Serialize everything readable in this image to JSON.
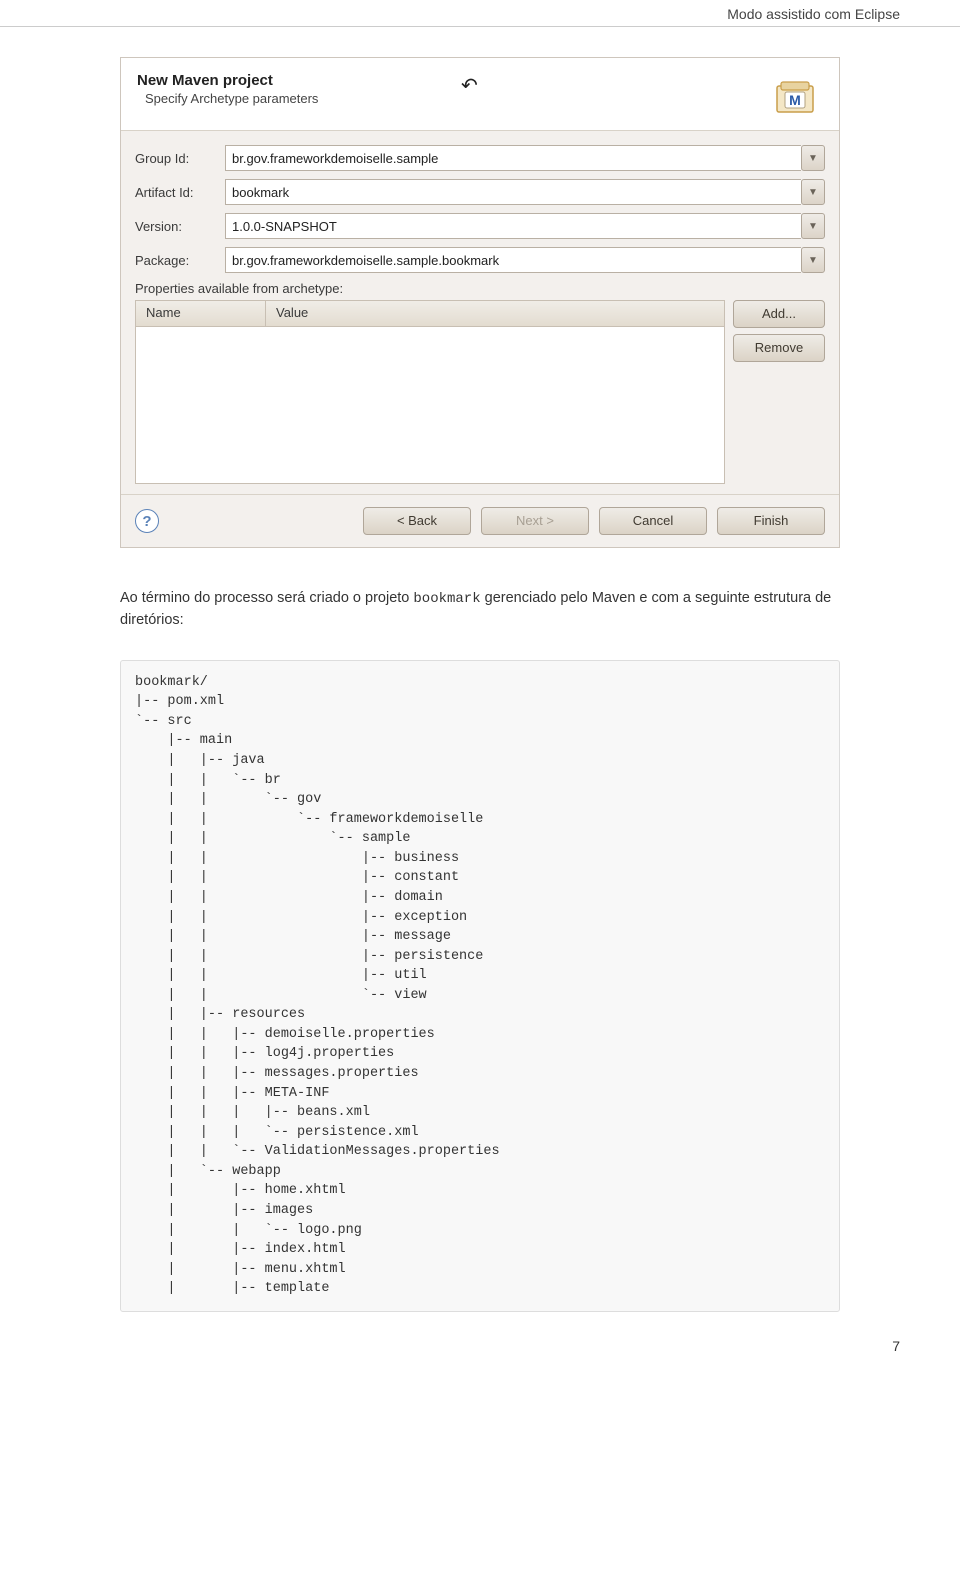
{
  "section_header": "Modo assistido com Eclipse",
  "dialog": {
    "title": "New Maven project",
    "subtitle": "Specify Archetype parameters",
    "fields": {
      "group_label": "Group Id:",
      "group_value": "br.gov.frameworkdemoiselle.sample",
      "artifact_label": "Artifact Id:",
      "artifact_value": "bookmark",
      "version_label": "Version:",
      "version_value": "1.0.0-SNAPSHOT",
      "package_label": "Package:",
      "package_value": "br.gov.frameworkdemoiselle.sample.bookmark"
    },
    "props_header": "Properties available from archetype:",
    "props_cols": {
      "name": "Name",
      "value": "Value"
    },
    "buttons": {
      "add": "Add...",
      "remove": "Remove",
      "back": "< Back",
      "next": "Next >",
      "cancel": "Cancel",
      "finish": "Finish"
    }
  },
  "body_text_pre": "Ao término do processo será criado o projeto ",
  "body_text_code": "bookmark",
  "body_text_post": " gerenciado pelo Maven e com a seguinte estrutura de diretórios:",
  "tree": "bookmark/\n|-- pom.xml\n`-- src\n    |-- main\n    |   |-- java\n    |   |   `-- br\n    |   |       `-- gov\n    |   |           `-- frameworkdemoiselle\n    |   |               `-- sample\n    |   |                   |-- business\n    |   |                   |-- constant\n    |   |                   |-- domain\n    |   |                   |-- exception\n    |   |                   |-- message\n    |   |                   |-- persistence\n    |   |                   |-- util\n    |   |                   `-- view\n    |   |-- resources\n    |   |   |-- demoiselle.properties\n    |   |   |-- log4j.properties\n    |   |   |-- messages.properties\n    |   |   |-- META-INF\n    |   |   |   |-- beans.xml\n    |   |   |   `-- persistence.xml\n    |   |   `-- ValidationMessages.properties\n    |   `-- webapp\n    |       |-- home.xhtml\n    |       |-- images\n    |       |   `-- logo.png\n    |       |-- index.html\n    |       |-- menu.xhtml\n    |       |-- template",
  "page_number": "7"
}
